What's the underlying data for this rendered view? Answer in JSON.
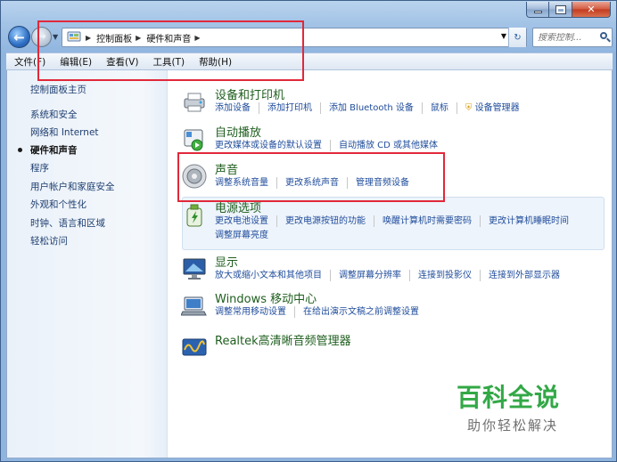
{
  "titlebar": {
    "minimize_glyph": "—",
    "maximize_glyph": "□",
    "close_glyph": "✕"
  },
  "nav": {
    "back_glyph": "←",
    "forward_glyph": "→"
  },
  "address": {
    "crumbs": [
      "控制面板",
      "硬件和声音"
    ],
    "search_placeholder": "搜索控制..."
  },
  "menu": {
    "items": [
      "文件(F)",
      "编辑(E)",
      "查看(V)",
      "工具(T)",
      "帮助(H)"
    ]
  },
  "sidebar": {
    "items": [
      {
        "label": "控制面板主页"
      },
      {
        "label": "系统和安全"
      },
      {
        "label": "网络和 Internet"
      },
      {
        "label": "硬件和声音",
        "current": true
      },
      {
        "label": "程序"
      },
      {
        "label": "用户帐户和家庭安全"
      },
      {
        "label": "外观和个性化"
      },
      {
        "label": "时钟、语言和区域"
      },
      {
        "label": "轻松访问"
      }
    ]
  },
  "categories": [
    {
      "title": "设备和打印机",
      "icon": "printer-icon",
      "links": [
        "添加设备",
        "添加打印机",
        "添加 Bluetooth 设备",
        "鼠标",
        "设备管理器"
      ]
    },
    {
      "title": "自动播放",
      "icon": "autoplay-icon",
      "links": [
        "更改媒体或设备的默认设置",
        "自动播放 CD 或其他媒体"
      ]
    },
    {
      "title": "声音",
      "icon": "speaker-icon",
      "links": [
        "调整系统音量",
        "更改系统声音",
        "管理音频设备"
      ]
    },
    {
      "title": "电源选项",
      "icon": "power-options-icon",
      "links": [
        "更改电池设置",
        "更改电源按钮的功能",
        "唤醒计算机时需要密码",
        "更改计算机睡眠时间",
        "调整屏幕亮度"
      ]
    },
    {
      "title": "显示",
      "icon": "display-icon",
      "links": [
        "放大或缩小文本和其他项目",
        "调整屏幕分辨率",
        "连接到投影仪",
        "连接到外部显示器"
      ]
    },
    {
      "title": "Windows 移动中心",
      "icon": "mobility-center-icon",
      "links": [
        "调整常用移动设置",
        "在给出演示文稿之前调整设置"
      ]
    },
    {
      "title": "Realtek高清晰音频管理器",
      "icon": "realtek-audio-icon",
      "links": []
    }
  ],
  "watermark": {
    "title": "百科全说",
    "subtitle": "助你轻松解决"
  },
  "colors": {
    "link": "#1f4c9b",
    "category_title": "#1e5e1e",
    "highlight_box": "#e1283a",
    "watermark_green": "#32a846"
  }
}
